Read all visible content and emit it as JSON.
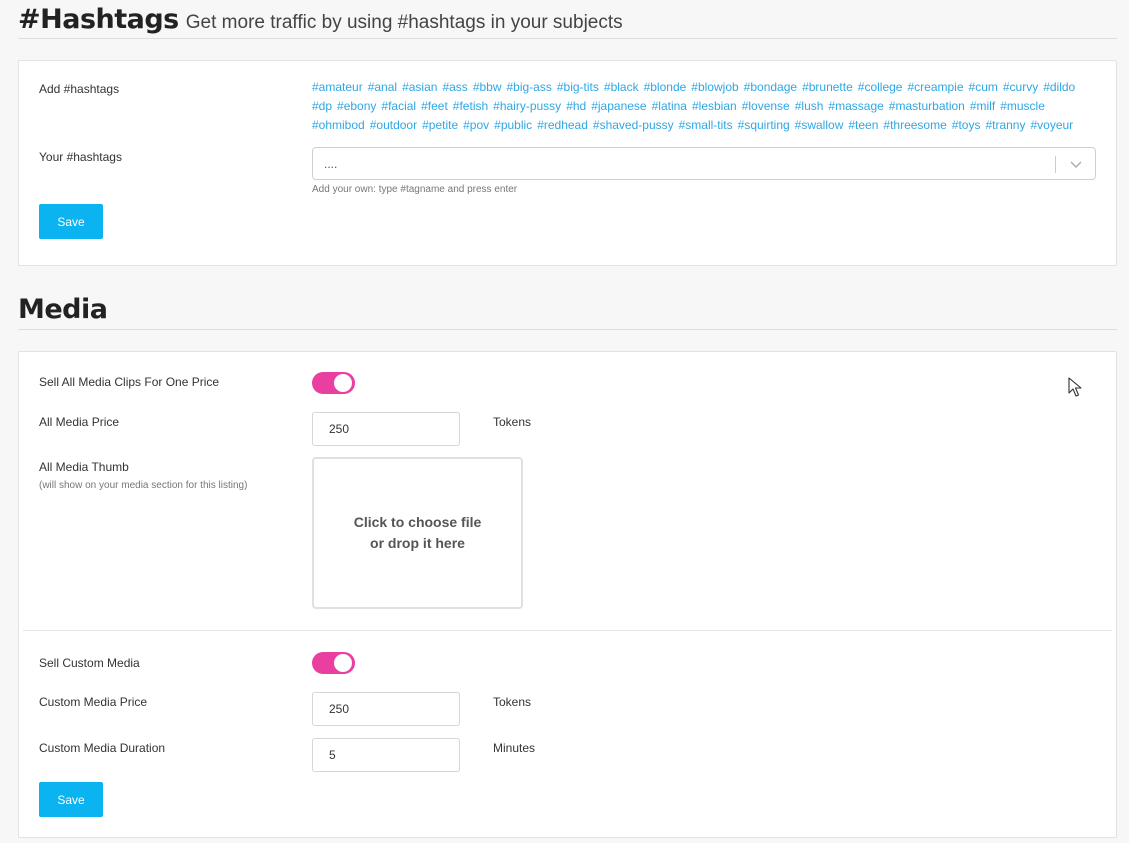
{
  "hashtags_section": {
    "title": "#Hashtags",
    "subtitle": "Get more traffic by using #hashtags in your subjects",
    "add_label": "Add #hashtags",
    "tags_line1": [
      "#amateur",
      "#anal",
      "#asian",
      "#ass",
      "#bbw",
      "#big-ass",
      "#big-tits",
      "#black",
      "#blonde",
      "#blowjob",
      "#bondage",
      "#brunette",
      "#college",
      "#creampie",
      "#cum",
      "#curvy",
      "#dildo"
    ],
    "tags_line2": [
      "#dp",
      "#ebony",
      "#facial",
      "#feet",
      "#fetish",
      "#hairy-pussy",
      "#hd",
      "#japanese",
      "#latina",
      "#lesbian",
      "#lovense",
      "#lush",
      "#massage",
      "#masturbation",
      "#milf",
      "#muscle"
    ],
    "tags_line3": [
      "#ohmibod",
      "#outdoor",
      "#petite",
      "#pov",
      "#public",
      "#redhead",
      "#shaved-pussy",
      "#small-tits",
      "#squirting",
      "#swallow",
      "#teen",
      "#threesome",
      "#toys",
      "#tranny",
      "#voyeur"
    ],
    "your_label": "Your #hashtags",
    "select_value": "....",
    "select_hint": "Add your own: type #tagname and press enter",
    "save_label": "Save"
  },
  "media_section": {
    "title": "Media",
    "sell_all_label": "Sell All Media Clips For One Price",
    "sell_all_on": true,
    "all_price_label": "All Media Price",
    "all_price_value": "250",
    "all_price_unit": "Tokens",
    "thumb_label": "All Media Thumb",
    "thumb_hint": "(will show on your media section for this listing)",
    "dropzone_line1": "Click to choose file",
    "dropzone_line2": "or drop it here",
    "sell_custom_label": "Sell Custom Media",
    "sell_custom_on": true,
    "custom_price_label": "Custom Media Price",
    "custom_price_value": "250",
    "custom_price_unit": "Tokens",
    "custom_duration_label": "Custom Media Duration",
    "custom_duration_value": "5",
    "custom_duration_unit": "Minutes",
    "save_label": "Save"
  },
  "colors": {
    "accent_blue": "#0bb4f0",
    "tag_blue": "#2fa7e4",
    "toggle_pink": "#e93fa1"
  }
}
